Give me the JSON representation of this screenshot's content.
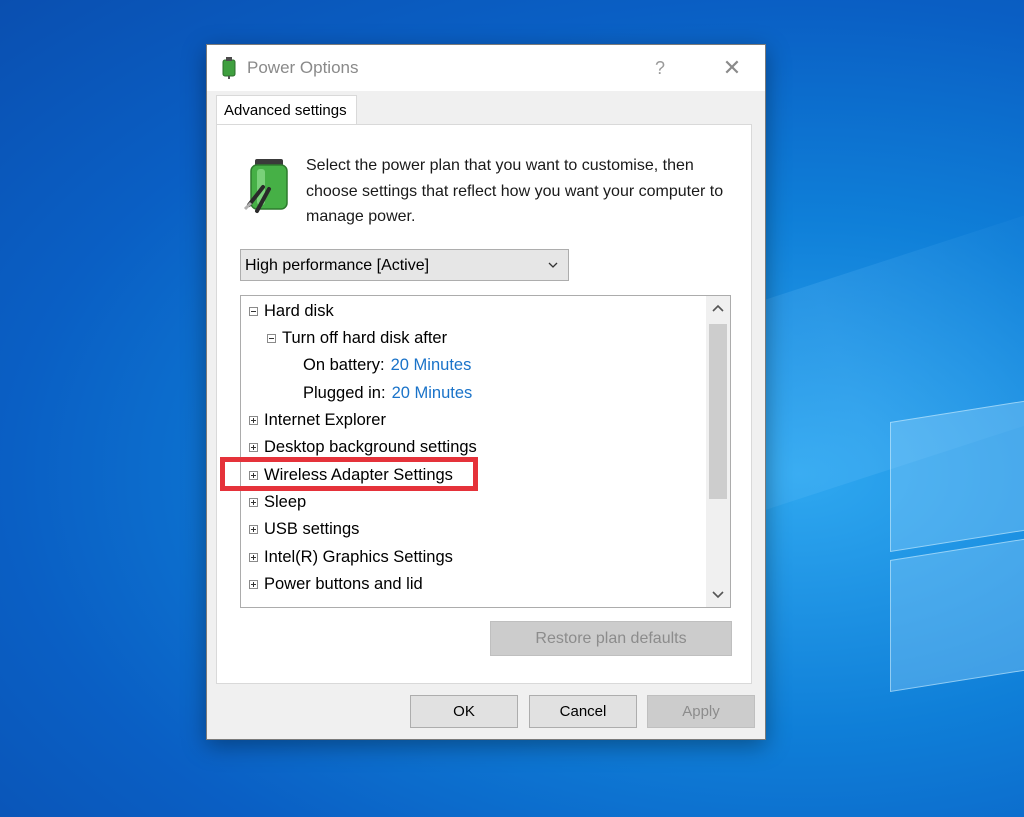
{
  "window": {
    "title": "Power Options",
    "help_glyph": "?",
    "close_glyph": "✕",
    "icon": "power-options-icon"
  },
  "tab": {
    "label": "Advanced settings"
  },
  "intro": {
    "text": "Select the power plan that you want to customise, then choose settings that reflect how you want your computer to manage power.",
    "icon": "battery-plug-icon"
  },
  "plan_select": {
    "value": "High performance [Active]"
  },
  "tree": {
    "rows": [
      {
        "label": "Hard disk",
        "expander": "minus"
      },
      {
        "label": "Turn off hard disk after",
        "expander": "minus"
      },
      {
        "label": "On battery:",
        "value": "20 Minutes"
      },
      {
        "label": "Plugged in:",
        "value": "20 Minutes"
      },
      {
        "label": "Internet Explorer",
        "expander": "plus"
      },
      {
        "label": "Desktop background settings",
        "expander": "plus"
      },
      {
        "label": "Wireless Adapter Settings",
        "expander": "plus",
        "highlighted": true
      },
      {
        "label": "Sleep",
        "expander": "plus"
      },
      {
        "label": "USB settings",
        "expander": "plus"
      },
      {
        "label": "Intel(R) Graphics Settings",
        "expander": "plus"
      },
      {
        "label": "Power buttons and lid",
        "expander": "plus"
      }
    ]
  },
  "restore_button": {
    "label": "Restore plan defaults"
  },
  "buttons": {
    "ok": "OK",
    "cancel": "Cancel",
    "apply": "Apply"
  },
  "colors": {
    "highlight": "#e5323a",
    "link": "#1a73c9",
    "desktop": "#0f7fd8"
  }
}
